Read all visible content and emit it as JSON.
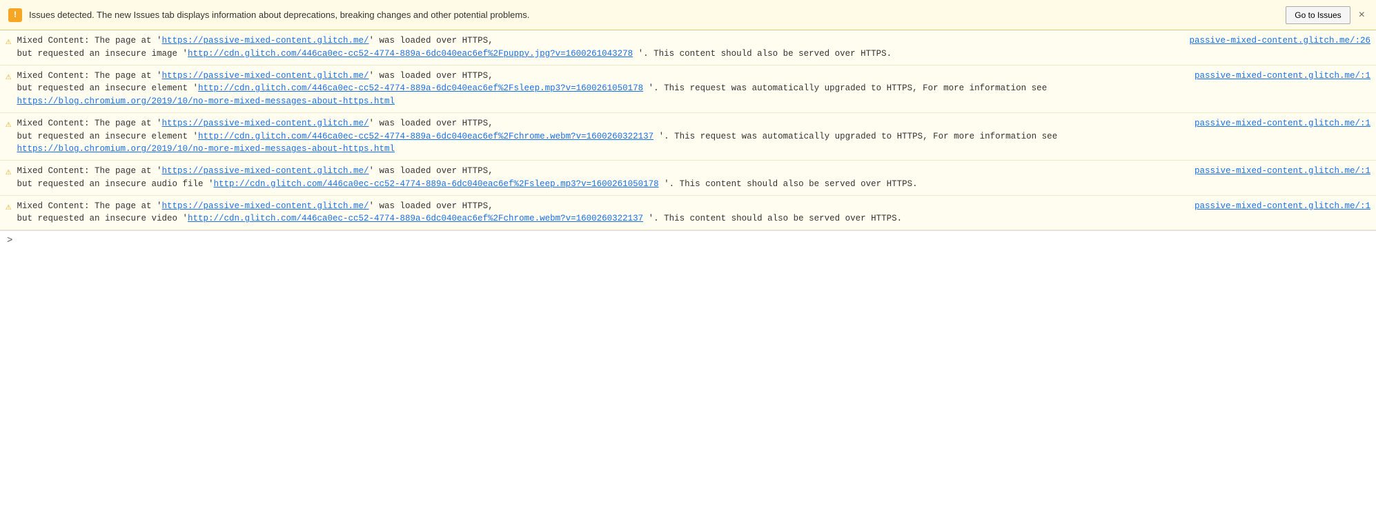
{
  "topbar": {
    "icon": "!",
    "message": "Issues detected. The new Issues tab displays information about deprecations, breaking changes and other potential problems.",
    "button_label": "Go to Issues",
    "close_label": "×"
  },
  "entries": [
    {
      "id": 1,
      "source_link": "passive-mixed-content.glitch.me/:26",
      "source_url": "https://passive-mixed-content.glitch.me/:26",
      "text_before": "Mixed Content: The page at '",
      "page_url": "https://passive-mixed-content.glitch.me/",
      "text_mid": "' was loaded over HTTPS,",
      "text_after": "but requested an insecure image '",
      "resource_url": "http://cdn.glitch.com/446ca0ec-cc52-4774-889a-6dc040eac6ef%2Fpuppy.jpg?v=1600261043278",
      "text_end": "'. This content should also be served over HTTPS.",
      "has_more_info": false,
      "more_info_url": "",
      "more_info_text": ""
    },
    {
      "id": 2,
      "source_link": "passive-mixed-content.glitch.me/:1",
      "source_url": "https://passive-mixed-content.glitch.me/:1",
      "text_before": "Mixed Content: The page at '",
      "page_url": "https://passive-mixed-content.glitch.me/",
      "text_mid": "' was loaded over HTTPS,",
      "text_after": "but requested an insecure element '",
      "resource_url": "http://cdn.glitch.com/446ca0ec-cc52-4774-889a-6dc040eac6ef%2Fsleep.mp3?v=1600261050178",
      "text_end": "'. This request was automatically upgraded to HTTPS, For more information see",
      "has_more_info": true,
      "more_info_url": "https://blog.chromium.org/2019/10/no-more-mixed-messages-about-https.html",
      "more_info_text": "https://blog.chromium.org/2019/10/no-more-mixed-messages-about-https.html"
    },
    {
      "id": 3,
      "source_link": "passive-mixed-content.glitch.me/:1",
      "source_url": "https://passive-mixed-content.glitch.me/:1",
      "text_before": "Mixed Content: The page at '",
      "page_url": "https://passive-mixed-content.glitch.me/",
      "text_mid": "' was loaded over HTTPS,",
      "text_after": "but requested an insecure element '",
      "resource_url": "http://cdn.glitch.com/446ca0ec-cc52-4774-889a-6dc040eac6ef%2Fchrome.webm?v=1600260322137",
      "text_end": "'. This request was automatically upgraded to HTTPS, For more information see",
      "has_more_info": true,
      "more_info_url": "https://blog.chromium.org/2019/10/no-more-mixed-messages-about-https.html",
      "more_info_text": "https://blog.chromium.org/2019/10/no-more-mixed-messages-about-https.html"
    },
    {
      "id": 4,
      "source_link": "passive-mixed-content.glitch.me/:1",
      "source_url": "https://passive-mixed-content.glitch.me/:1",
      "text_before": "Mixed Content: The page at '",
      "page_url": "https://passive-mixed-content.glitch.me/",
      "text_mid": "' was loaded over HTTPS,",
      "text_after": "but requested an insecure audio file '",
      "resource_url": "http://cdn.glitch.com/446ca0ec-cc52-4774-889a-6dc040eac6ef%2Fsleep.mp3?v=1600261050178",
      "text_end": "'. This content should also be served over HTTPS.",
      "has_more_info": false,
      "more_info_url": "",
      "more_info_text": ""
    },
    {
      "id": 5,
      "source_link": "passive-mixed-content.glitch.me/:1",
      "source_url": "https://passive-mixed-content.glitch.me/:1",
      "text_before": "Mixed Content: The page at '",
      "page_url": "https://passive-mixed-content.glitch.me/",
      "text_mid": "' was loaded over HTTPS,",
      "text_after": "but requested an insecure video '",
      "resource_url": "http://cdn.glitch.com/446ca0ec-cc52-4774-889a-6dc040eac6ef%2Fchrome.webm?v=1600260322137",
      "text_end": "'. This content should also be served over HTTPS.",
      "has_more_info": false,
      "more_info_url": "",
      "more_info_text": ""
    }
  ],
  "bottom_bar": {
    "prompt": ">"
  }
}
